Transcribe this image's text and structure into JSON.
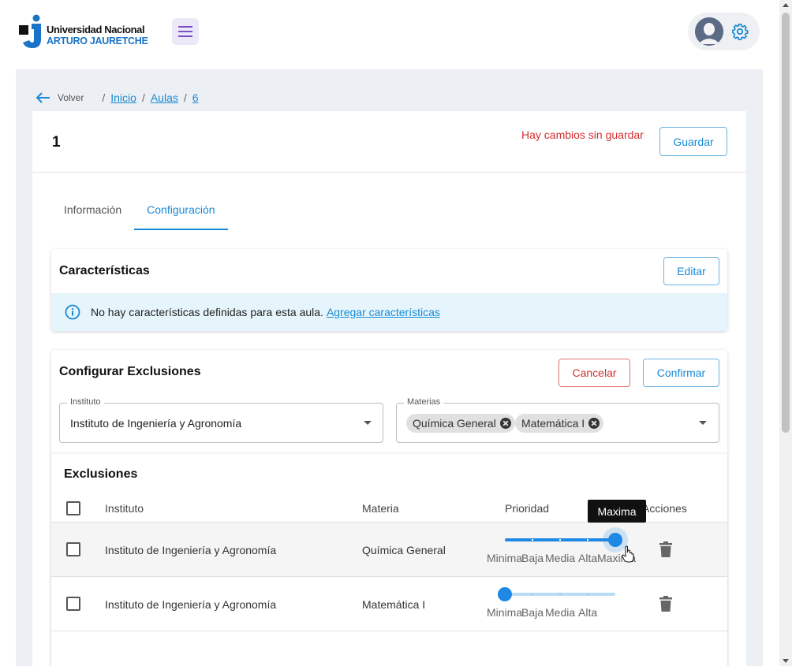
{
  "header": {
    "logo_line1": "Universidad Nacional",
    "logo_line2": "ARTURO JAURETCHE",
    "brand_colors": {
      "blue": "#1a73c7",
      "black": "#111111"
    }
  },
  "breadcrumb": {
    "back_label": "Volver",
    "items": [
      "Inicio",
      "Aulas",
      "6"
    ]
  },
  "page": {
    "title": "1",
    "unsaved_message": "Hay cambios sin guardar",
    "save_label": "Guardar"
  },
  "tabs": [
    {
      "label": "Información",
      "active": false
    },
    {
      "label": "Configuración",
      "active": true
    }
  ],
  "characteristics": {
    "title": "Características",
    "edit_label": "Editar",
    "info_text": "No hay características definidas para esta aula.",
    "info_link": "Agregar características"
  },
  "exclusions_config": {
    "title": "Configurar Exclusiones",
    "cancel_label": "Cancelar",
    "confirm_label": "Confirmar",
    "instituto_label": "Instituto",
    "instituto_value": "Instituto de Ingeniería y Agronomía",
    "materias_label": "Materias",
    "materias_chips": [
      "Química General",
      "Matemática I"
    ]
  },
  "exclusions_table": {
    "title": "Exclusiones",
    "columns": [
      "Instituto",
      "Materia",
      "Prioridad",
      "Acciones"
    ],
    "priority_levels": [
      "Minima",
      "Baja",
      "Media",
      "Alta",
      "Maxima"
    ],
    "rows": [
      {
        "instituto": "Instituto de Ingeniería y Agronomía",
        "materia": "Química General",
        "priority": "Maxima",
        "priority_index": 4
      },
      {
        "instituto": "Instituto de Ingeniería y Agronomía",
        "materia": "Matemática I",
        "priority": "Minima",
        "priority_index": 0
      }
    ],
    "tooltip": "Maxima"
  },
  "colors": {
    "accent": "#1a8ad6",
    "danger": "#d32f2f",
    "info_bg": "#e5f5fb",
    "slider": "#1e88e5"
  }
}
